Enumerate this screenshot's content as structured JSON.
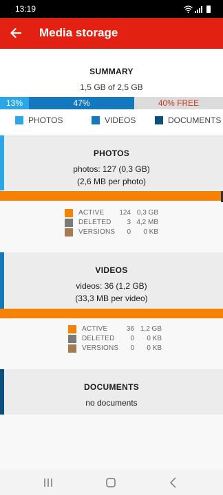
{
  "status_bar": {
    "time": "13:19",
    "icons": [
      "wifi-icon",
      "signal-icon",
      "battery-icon"
    ]
  },
  "app_bar": {
    "title": "Media storage",
    "back_icon": "arrow-left-icon"
  },
  "colors": {
    "app_bar": "#e32112",
    "photos": "#2ba6e6",
    "videos": "#1378bd",
    "documents": "#0a4f7d",
    "free": "#dcdcdd",
    "free_text": "#c63a1f",
    "active": "#f58205",
    "deleted": "#7a7a7a",
    "versions": "#a57c52"
  },
  "summary": {
    "heading": "SUMMARY",
    "total": "1,5 GB of 2,5 GB",
    "segments": {
      "photos": {
        "label": "13%",
        "fraction": 0.13
      },
      "videos": {
        "label": "47%",
        "fraction": 0.47
      },
      "free": {
        "label": "40% FREE",
        "fraction": 0.4
      }
    },
    "legend": {
      "photos": "PHOTOS",
      "videos": "VIDEOS",
      "documents": "DOCUMENTS"
    }
  },
  "photos": {
    "heading": "PHOTOS",
    "count_line": "photos: 127 (0,3 GB)",
    "per_item": "(2,6 MB per photo)",
    "stats": [
      {
        "label": "ACTIVE",
        "count": "124",
        "size": "0,3 GB"
      },
      {
        "label": "DELETED",
        "count": "3",
        "size": "4,2 MB"
      },
      {
        "label": "VERSIONS",
        "count": "0",
        "size": "0 KB"
      }
    ]
  },
  "videos": {
    "heading": "VIDEOS",
    "count_line": "videos: 36 (1,2 GB)",
    "per_item": "(33,3 MB per video)",
    "stats": [
      {
        "label": "ACTIVE",
        "count": "36",
        "size": "1,2 GB"
      },
      {
        "label": "DELETED",
        "count": "0",
        "size": "0 KB"
      },
      {
        "label": "VERSIONS",
        "count": "0",
        "size": "0 KB"
      }
    ]
  },
  "documents": {
    "heading": "DOCUMENTS",
    "empty_text": "no documents"
  },
  "nav": {
    "icons": [
      "recent-apps-icon",
      "home-icon",
      "back-icon"
    ]
  }
}
